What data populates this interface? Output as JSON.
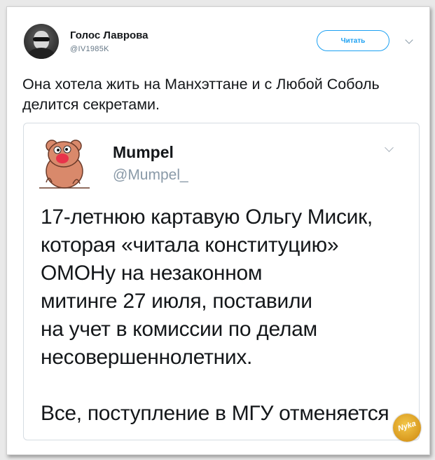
{
  "tweet": {
    "author_name": "Голос Лаврова",
    "author_handle": "@IV1985K",
    "follow_label": "Читать",
    "text": "Она хотела жить на Манхэттане и с Любой Соболь делится секретами."
  },
  "quoted_tweet": {
    "author_name": "Mumpel",
    "author_handle": "@Mumpel_",
    "paragraphs": [
      "17-летнюю картавую Ольгу Мисик, которая «читала конституцию» ОМОНу на незаконном митинге 27 июля, поставили на учет в комиссии по делам несовершеннолетних.",
      "Все, поступление в МГУ отменяется"
    ],
    "lines": [
      "17-летнюю картавую Ольгу Мисик,",
      "которая «читала конституцию»",
      "ОМОНу на незаконном",
      "митинге 27 июля, поставили",
      "на учет в комиссии по делам",
      "несовершеннолетних."
    ],
    "last_line": "Все, поступление в МГУ отменяется"
  },
  "watermark": {
    "text": "Nyka"
  },
  "colors": {
    "accent": "#1da1f2",
    "text": "#14171a",
    "muted": "#657786"
  },
  "icons": {
    "caret": "chevron-down-icon",
    "avatar": "user-avatar",
    "quote_avatar": "cartoon-bear-avatar"
  }
}
